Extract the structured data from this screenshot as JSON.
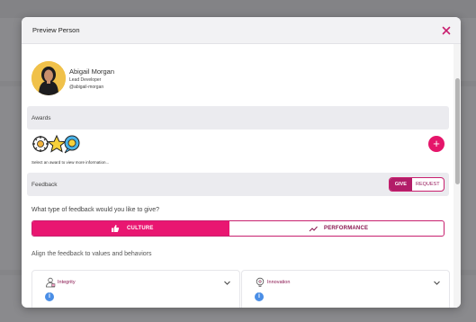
{
  "modal": {
    "title": "Preview Person"
  },
  "person": {
    "name": "Abigail Morgan",
    "role": "Lead Developer",
    "handle": "@abigail-morgan"
  },
  "awards": {
    "section_label": "Awards",
    "hint": "Select an award to view more information...",
    "add_label": "+"
  },
  "feedback": {
    "section_label": "Feedback",
    "toggle": {
      "give": "GIVE",
      "request": "REQUEST",
      "selected": "GIVE"
    },
    "question": "What type of feedback would you like to give?",
    "types": [
      {
        "label": "CULTURE",
        "icon": "thumbs-up-icon",
        "selected": true
      },
      {
        "label": "PERFORMANCE",
        "icon": "trend-line-icon",
        "selected": false
      }
    ],
    "align_label": "Align the feedback to values and behaviors",
    "values": [
      {
        "title": "Integrity",
        "icon": "person-badge-icon"
      },
      {
        "title": "Innovation",
        "icon": "lightbulb-gear-icon"
      }
    ],
    "info_glyph": "i"
  },
  "colors": {
    "accent": "#e91671",
    "accent_dark": "#b21d68",
    "link": "#8a1650",
    "info": "#4a8ee6"
  }
}
